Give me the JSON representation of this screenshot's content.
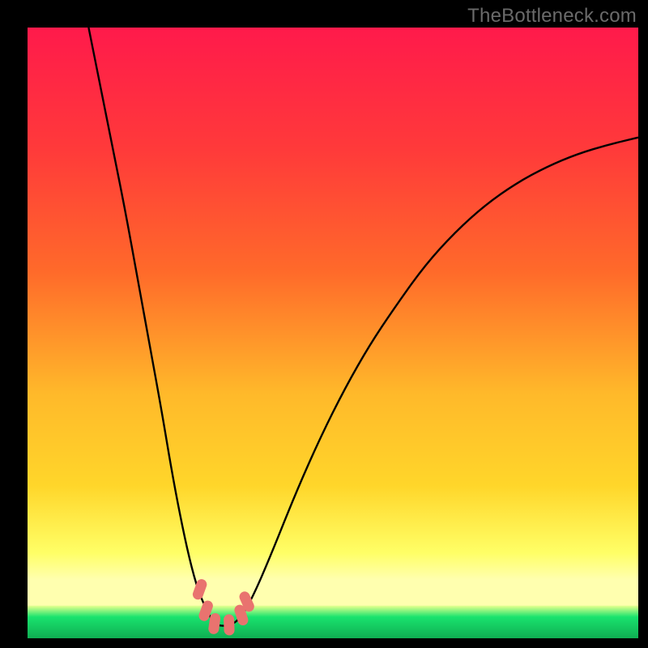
{
  "watermark": "TheBottleneck.com",
  "colors": {
    "top": "#ff1a4b",
    "mid1": "#ff6a2a",
    "mid2": "#ffd62a",
    "mid3": "#ffff66",
    "paleBand": "#ffffb0",
    "green": "#19e36e",
    "black": "#000000",
    "curve": "#000000",
    "marker": "#e9736f"
  },
  "layout": {
    "imageSize": 800,
    "plotLeft": 34,
    "plotTop": 34,
    "plotWidth": 754,
    "plotHeight": 754
  },
  "chart_data": {
    "type": "line",
    "title": "",
    "xlabel": "",
    "ylabel": "",
    "xlim": [
      0,
      100
    ],
    "ylim": [
      0,
      100
    ],
    "legend": false,
    "grid": false,
    "series": [
      {
        "name": "curve",
        "x": [
          10,
          12,
          14,
          16,
          18,
          20,
          22,
          23.5,
          25,
          26.5,
          28,
          30,
          31,
          32,
          33.5,
          35,
          37,
          40,
          44,
          48,
          52,
          56,
          60,
          65,
          70,
          75,
          80,
          85,
          90,
          95,
          100
        ],
        "y": [
          100,
          90,
          80,
          70,
          59,
          48,
          37,
          28,
          20,
          13,
          7.5,
          3.2,
          2.2,
          2.0,
          2.2,
          3.5,
          7,
          14,
          24,
          33,
          41,
          48,
          54,
          61,
          66.5,
          71,
          74.5,
          77.2,
          79.3,
          80.8,
          82
        ]
      }
    ],
    "markers": [
      {
        "x": 28.2,
        "y": 8.0
      },
      {
        "x": 29.2,
        "y": 4.5
      },
      {
        "x": 30.6,
        "y": 2.4
      },
      {
        "x": 33.0,
        "y": 2.2
      },
      {
        "x": 35.0,
        "y": 3.8
      },
      {
        "x": 35.9,
        "y": 6.0
      }
    ],
    "annotations": []
  }
}
